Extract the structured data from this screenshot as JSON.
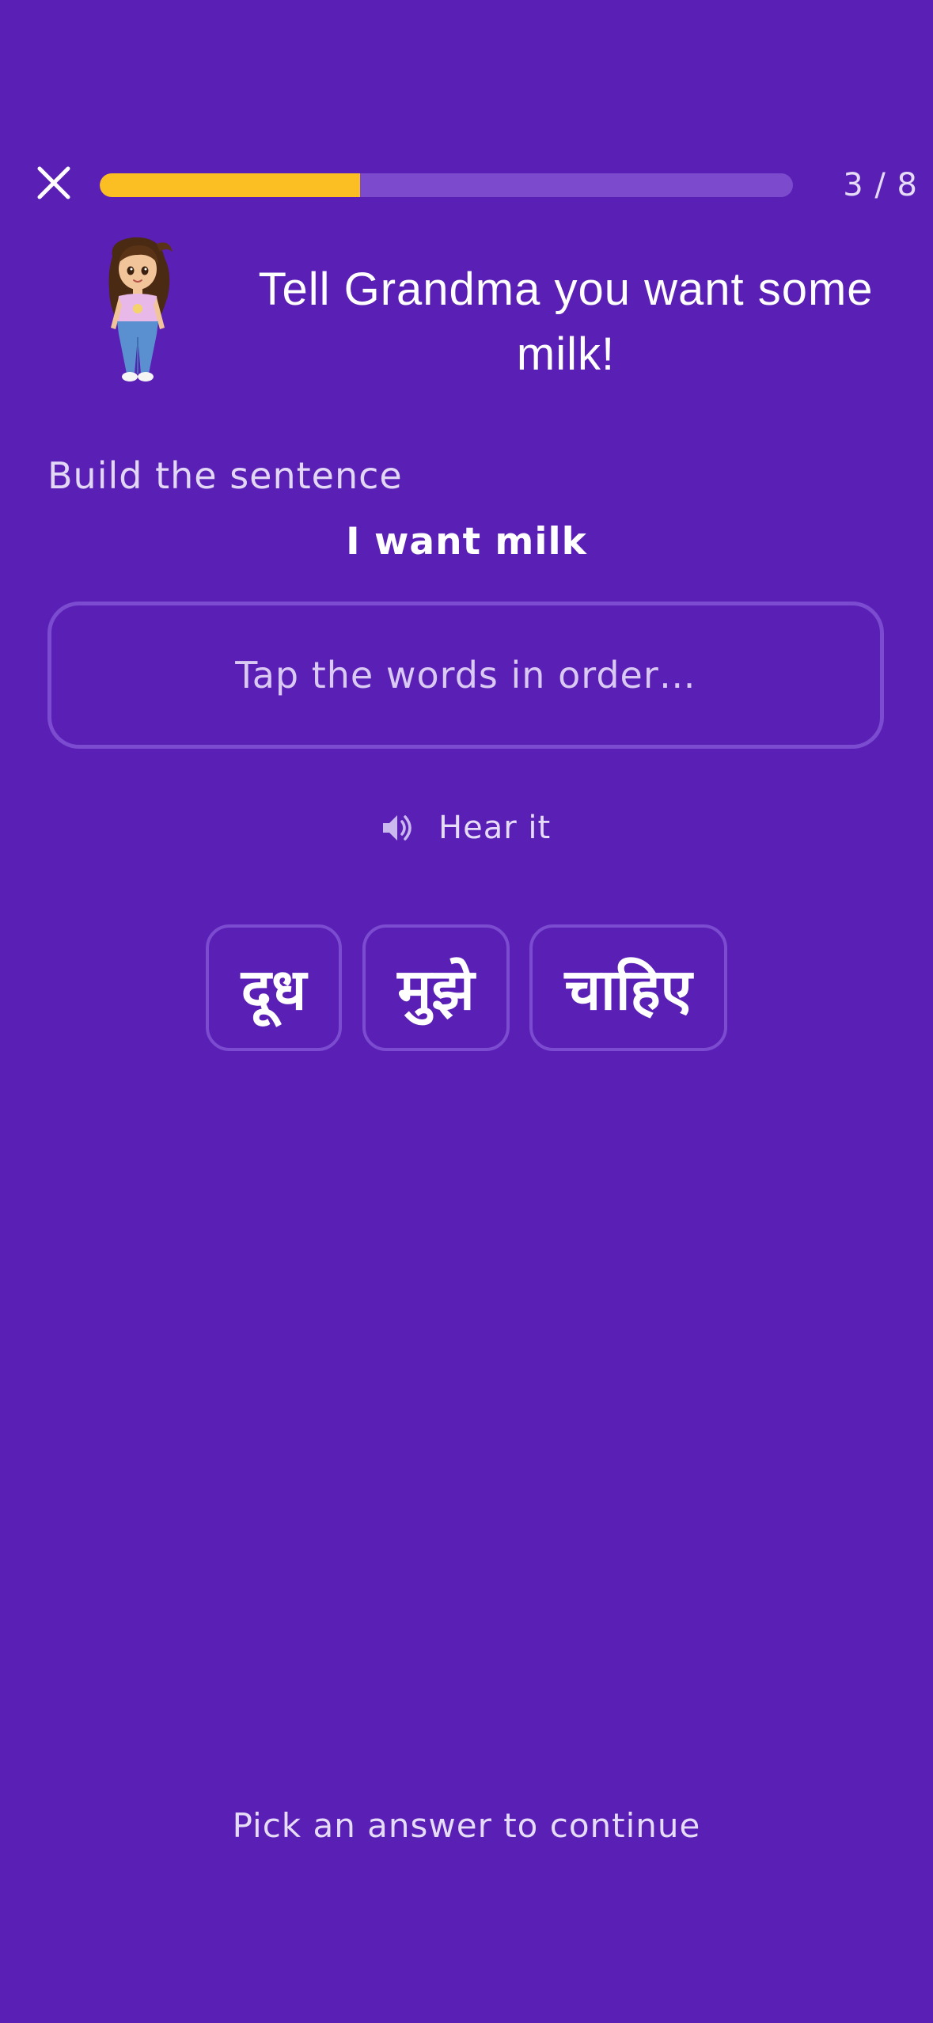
{
  "header": {
    "close_icon": "close-icon",
    "progress": {
      "current": 3,
      "total": 8,
      "fraction": 0.375,
      "label": "3 / 8"
    }
  },
  "prompt": {
    "character": "girl-character-illustration",
    "title": "Tell Grandma you want some milk!"
  },
  "exercise": {
    "instruction": "Build the sentence",
    "target_sentence": "I want milk",
    "answer_placeholder": "Tap the words in order…",
    "hear_label": "Hear it",
    "hear_icon": "speaker-icon",
    "word_chips": [
      "दूध",
      "मुझे",
      "चाहिए"
    ]
  },
  "footer": {
    "hint": "Pick an answer to continue"
  },
  "colors": {
    "background": "#5a1fb5",
    "progress_fill": "#fbbf24",
    "progress_track": "#7c4bcd",
    "border": "#7b4bd0"
  }
}
